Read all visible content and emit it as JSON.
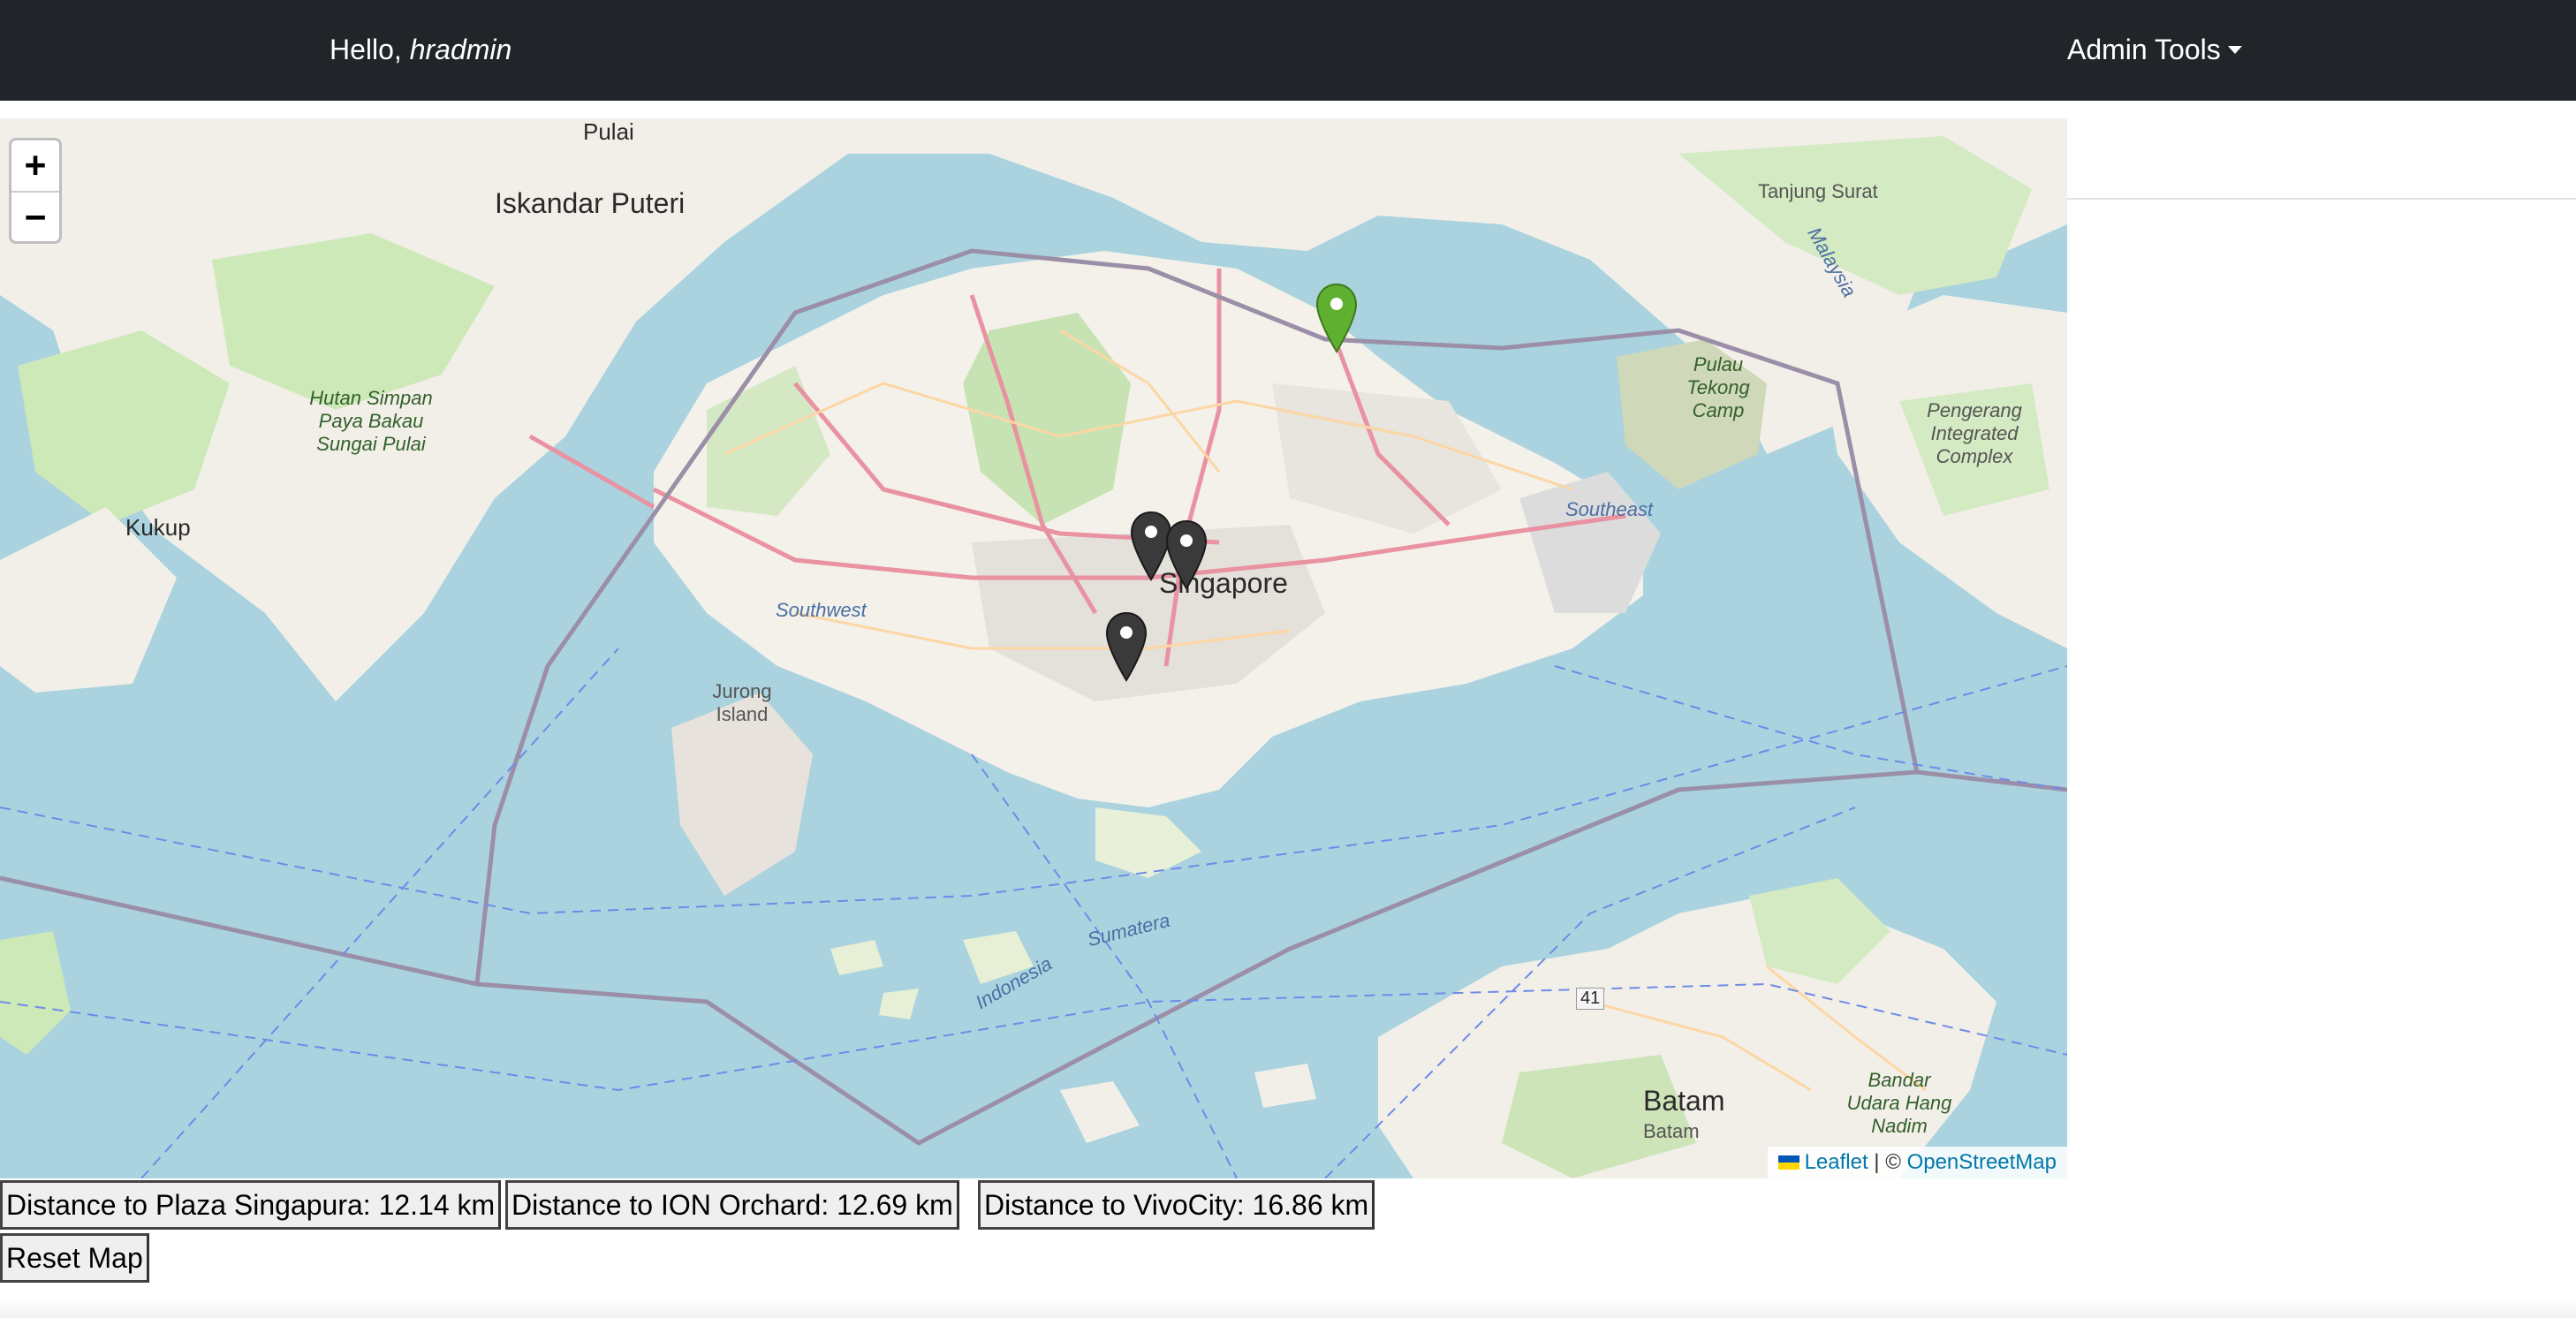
{
  "navbar": {
    "greeting_prefix": "Hello, ",
    "username": "hradmin",
    "admin_tools_label": "Admin Tools"
  },
  "map": {
    "zoom_in": "+",
    "zoom_out": "−",
    "attribution": {
      "leaflet": "Leaflet",
      "separator": " | © ",
      "osm": "OpenStreetMap"
    },
    "labels": {
      "iskandar": "Iskandar Puteri",
      "pulai": "Pulai",
      "hutan": "Hutan Simpan Paya Bakau Sungai Pulai",
      "kukup": "Kukup",
      "jurong": "Jurong Island",
      "southwest": "Southwest",
      "singapore": "Singapore",
      "southeast": "Southeast",
      "tanjung": "Tanjung Surat",
      "tekong": "Pulau Tekong Camp",
      "pengerang": "Pengerang Integrated Complex",
      "sumatera": "Sumatera",
      "indonesia": "Indonesia",
      "batam": "Batam",
      "batam_small": "Batam",
      "bandara": "Bandar Udara Hang Nadim",
      "malaysia": "Malaysia",
      "route41": "41"
    },
    "markers": [
      {
        "name": "current-location",
        "color": "#5fb030"
      },
      {
        "name": "Plaza Singapura",
        "color": "#3a3a3a"
      },
      {
        "name": "ION Orchard",
        "color": "#3a3a3a"
      },
      {
        "name": "VivoCity",
        "color": "#3a3a3a"
      }
    ]
  },
  "buttons": {
    "distances": [
      "Distance to Plaza Singapura: 12.14 km",
      "Distance to ION Orchard: 12.69 km",
      "Distance to VivoCity: 16.86 km"
    ],
    "reset": "Reset Map"
  }
}
